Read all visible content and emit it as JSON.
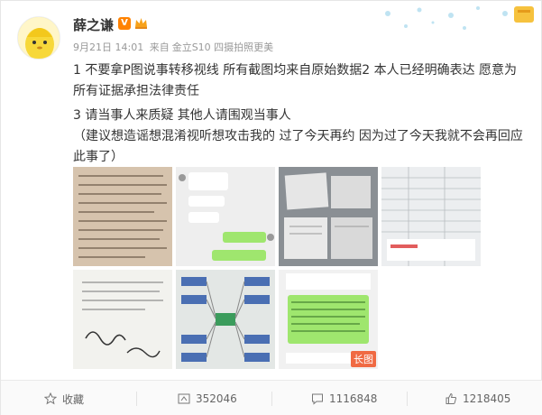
{
  "post": {
    "username": "薛之谦",
    "vip_badge": "V",
    "timestamp": "9月21日 14:01",
    "source_prefix": "来自",
    "source": "金立S10 四摄拍照更美",
    "content_line1": "1 不要拿P图说事转移视线 所有截图均来自原始数据2 本人已经明确表达 愿意为所有证据承担法律责任",
    "content_line2": "3 请当事人来质疑 其他人请围观当事人",
    "content_line3": "（建议想造谣想混淆视听想攻击我的 过了今天再约 因为过了今天我就不会再回应此事了）"
  },
  "images": {
    "long_image_label": "长图",
    "count": 7
  },
  "actions": {
    "favorite_label": "收藏",
    "repost_count": "352046",
    "comment_count": "1116848",
    "like_count": "1218405"
  },
  "colors": {
    "vip_orange": "#ff8200",
    "long_image_badge": "#f06a43",
    "meta_gray": "#999999"
  }
}
